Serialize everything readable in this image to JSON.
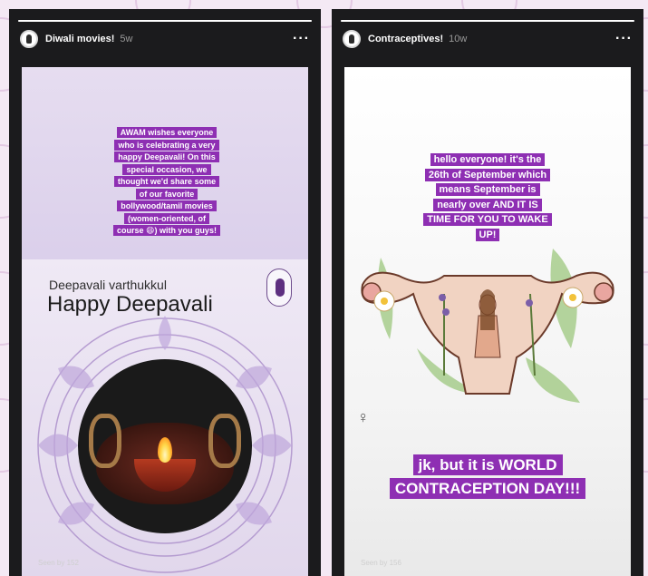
{
  "stories": [
    {
      "title": "Diwali movies!",
      "time": "5w",
      "more_icon": "more-icon",
      "progress": 1.0,
      "caption_lines": [
        "AWAM wishes everyone",
        "who is celebrating a very",
        "happy Deepavali! On this",
        "special occasion, we",
        "thought we'd share some",
        "of our favorite",
        "bollywood/tamil movies",
        "(women-oriented, of",
        "course 😄) with you guys!"
      ],
      "card_subtitle": "Deepavali varthukkul",
      "card_title": "Happy Deepavali",
      "seen": "Seen by 152"
    },
    {
      "title": "Contraceptives!",
      "time": "10w",
      "more_icon": "more-icon",
      "progress": 1.0,
      "caption_lines": [
        "hello everyone! it's the",
        "26th of September which",
        "means September is",
        "nearly over AND IT IS",
        "TIME FOR YOU TO WAKE",
        "UP!"
      ],
      "venus_symbol": "♀",
      "banner_lines": [
        "jk, but it is WORLD",
        "CONTRACEPTION DAY!!!"
      ],
      "seen": "Seen by 156"
    }
  ],
  "colors": {
    "caption_bg": "#8e2fb3",
    "story_bg": "#1b1b1d",
    "page_bg": "#f4e9f4"
  }
}
